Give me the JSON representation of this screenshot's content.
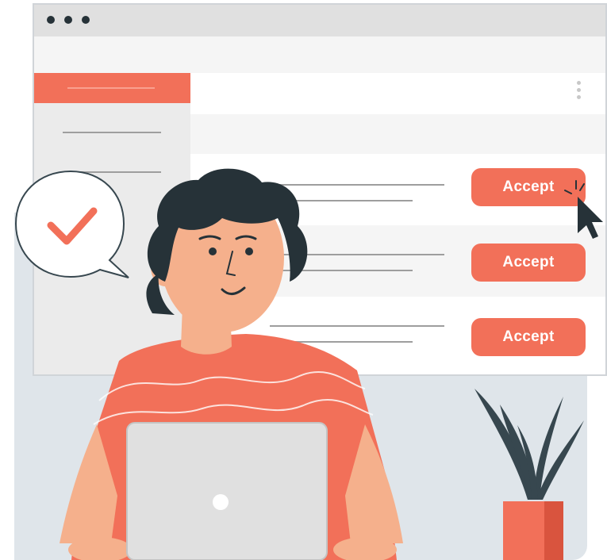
{
  "window": {
    "title_dots": 3,
    "menu_icon": "kebab-menu-icon"
  },
  "requests": [
    {
      "action_label": "Accept"
    },
    {
      "action_label": "Accept"
    },
    {
      "action_label": "Accept"
    }
  ],
  "speech_bubble": {
    "icon": "checkmark-icon"
  },
  "cursor": {
    "icon": "mouse-pointer-icon"
  },
  "colors": {
    "accent": "#f27059",
    "dark": "#263238",
    "skin": "#f5b08c",
    "panel": "#dfe5ea"
  }
}
